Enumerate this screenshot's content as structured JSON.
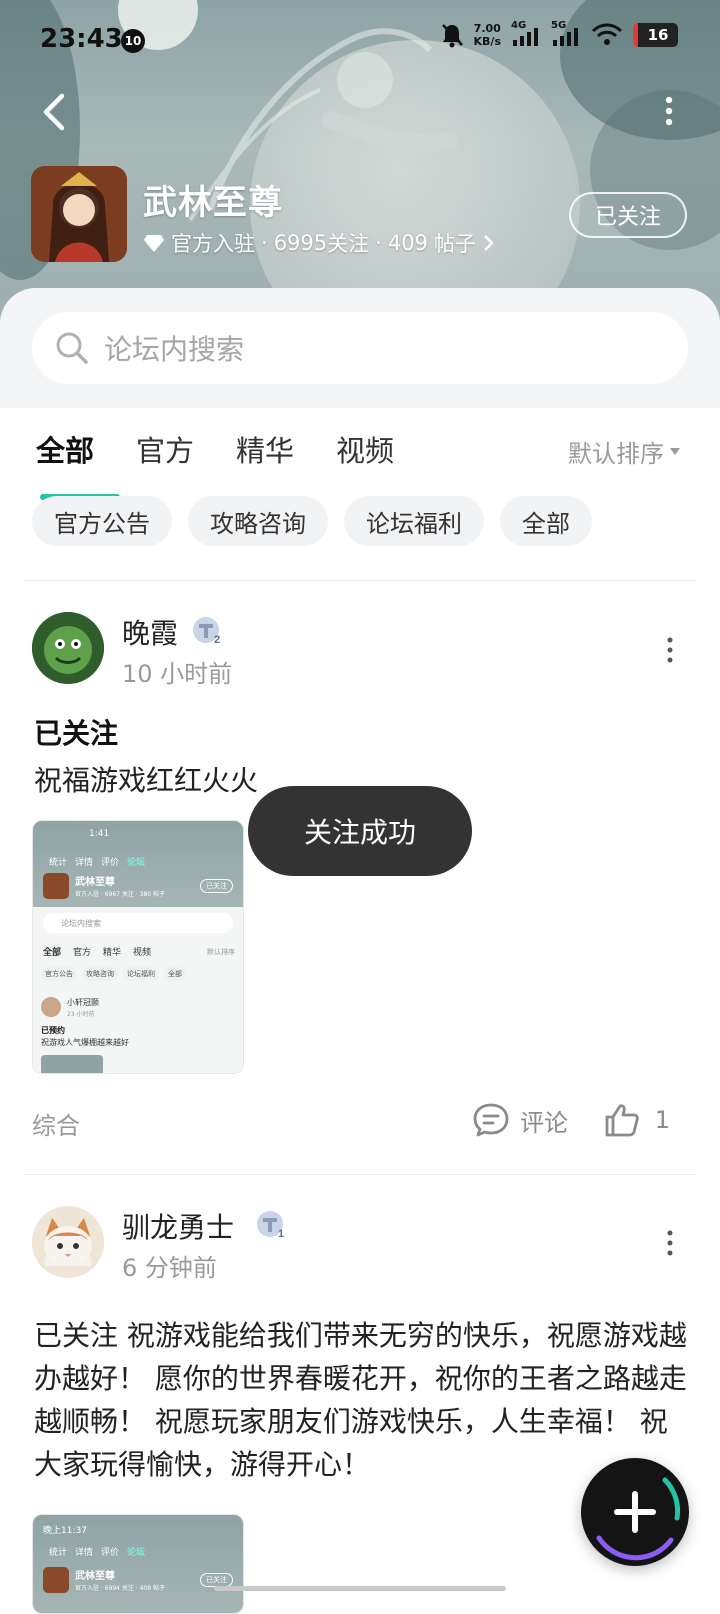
{
  "status_bar": {
    "time": "23:43",
    "notif_badge": "10",
    "net_speed_value": "7.00",
    "net_speed_unit": "KB/s",
    "sig1": "4G",
    "sig2": "5G",
    "battery": "16"
  },
  "game": {
    "title": "武林至尊",
    "official_label": "官方入驻",
    "follow_count": "6995",
    "follow_suffix": "关注",
    "post_count": "409",
    "post_suffix": "帖子",
    "dot": "·",
    "follow_button": "已关注"
  },
  "search": {
    "placeholder": "论坛内搜索"
  },
  "tabs": [
    "全部",
    "官方",
    "精华",
    "视频"
  ],
  "sort_label": "默认排序",
  "chips": [
    "官方公告",
    "攻略咨询",
    "论坛福利",
    "全部"
  ],
  "posts": [
    {
      "username": "晚霞",
      "level": "2",
      "time": "10 小时前",
      "title": "已关注",
      "body": "祝福游戏红红火火",
      "thumb": {
        "time": "1:41",
        "tabs": [
          "统计",
          "详情",
          "评价",
          "论坛"
        ],
        "title": "武林至尊",
        "meta": "官方入驻 · 6967 关注 · 380 帖子",
        "follow": "已关注",
        "search": "论坛内搜索",
        "nav": [
          "全部",
          "官方",
          "精华",
          "视频"
        ],
        "sort": "默认排序",
        "chips": [
          "官方公告",
          "攻略咨询",
          "论坛福利",
          "全部"
        ],
        "user": "小轩冠颢",
        "user_time": "23 小时前",
        "post_title": "已预约",
        "post_body": "祝游戏人气爆棚越来越好"
      },
      "category": "综合",
      "comment_label": "评论",
      "likes": "1"
    },
    {
      "username": "驯龙勇士",
      "level": "1",
      "time": "6 分钟前",
      "body": "已关注 祝游戏能给我们带来无穷的快乐，祝愿游戏越办越好！ 愿你的世界春暖花开，祝你的王者之路越走越顺畅！ 祝愿玩家朋友们游戏快乐，人生幸福！ 祝大家玩得愉快，游得开心！",
      "thumb": {
        "time": "晚上11:37",
        "tabs": [
          "统计",
          "详情",
          "评价",
          "论坛"
        ],
        "title": "武林至尊",
        "meta": "官方入驻 · 6994 关注 · 408 帖子",
        "follow": "已关注"
      }
    }
  ],
  "toast": "关注成功",
  "colors": {
    "accent": "#22c3a8",
    "toast_bg": "#333333",
    "fab_bg": "#141414"
  }
}
